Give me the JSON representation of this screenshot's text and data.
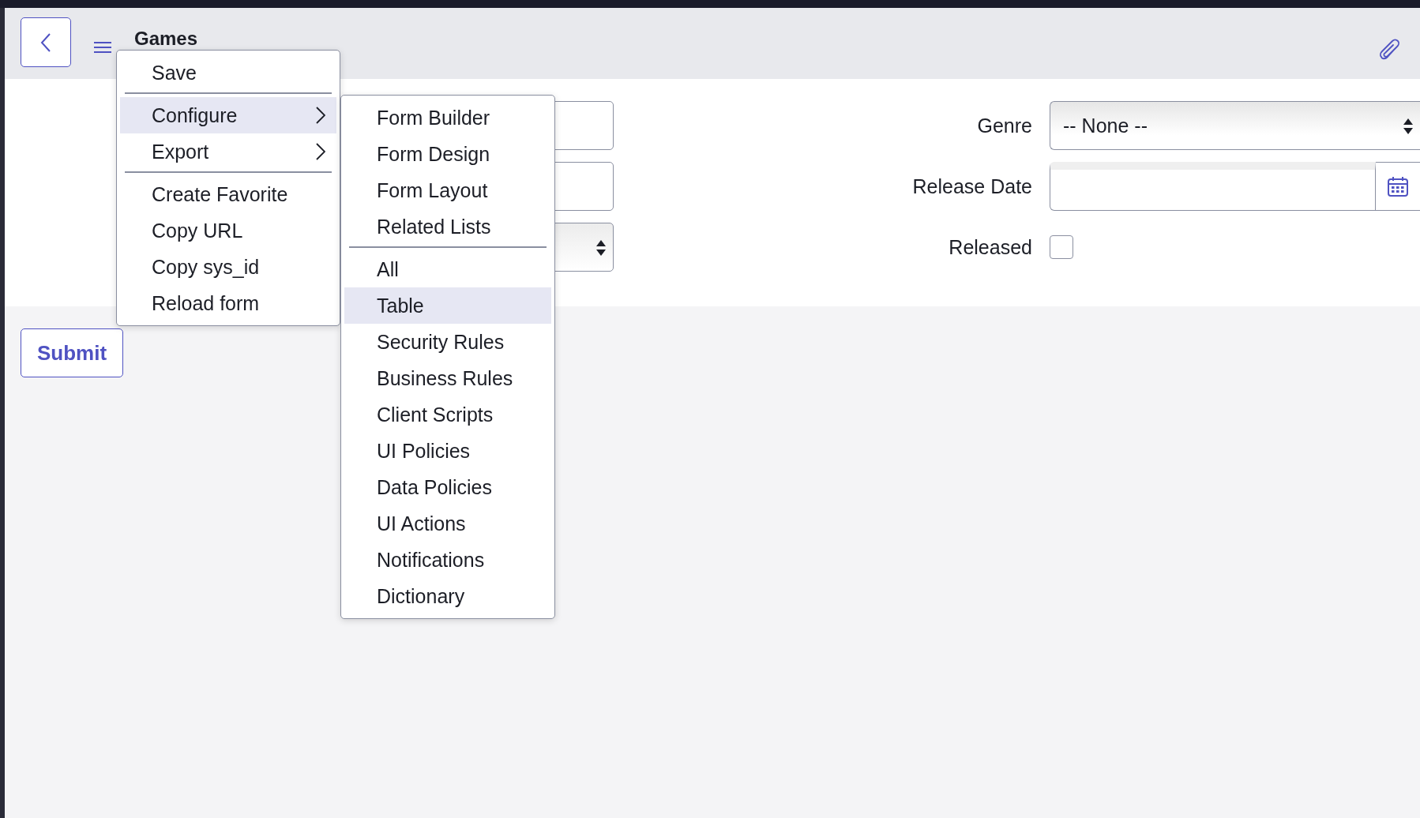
{
  "header": {
    "title": "Games"
  },
  "form": {
    "left_fields": [
      {
        "kind": "text"
      },
      {
        "kind": "text"
      },
      {
        "kind": "select"
      }
    ],
    "right_fields": [
      {
        "kind": "select",
        "label": "Genre",
        "value": "-- None --"
      },
      {
        "kind": "date",
        "label": "Release Date"
      },
      {
        "kind": "checkbox",
        "label": "Released",
        "checked": false
      }
    ]
  },
  "submit_button": {
    "label": "Submit"
  },
  "context_menu": {
    "groups": [
      [
        {
          "label": "Save",
          "selected": false,
          "has_submenu": false
        }
      ],
      [
        {
          "label": "Configure",
          "selected": true,
          "has_submenu": true
        },
        {
          "label": "Export",
          "selected": false,
          "has_submenu": true
        }
      ],
      [
        {
          "label": "Create Favorite",
          "selected": false,
          "has_submenu": false
        },
        {
          "label": "Copy URL",
          "selected": false,
          "has_submenu": false
        },
        {
          "label": "Copy sys_id",
          "selected": false,
          "has_submenu": false
        },
        {
          "label": "Reload form",
          "selected": false,
          "has_submenu": false
        }
      ]
    ]
  },
  "submenu": {
    "groups": [
      [
        {
          "label": "Form Builder",
          "selected": false
        },
        {
          "label": "Form Design",
          "selected": false
        },
        {
          "label": "Form Layout",
          "selected": false
        },
        {
          "label": "Related Lists",
          "selected": false
        }
      ],
      [
        {
          "label": "All",
          "selected": false
        },
        {
          "label": "Table",
          "selected": true
        },
        {
          "label": "Security Rules",
          "selected": false
        },
        {
          "label": "Business Rules",
          "selected": false
        },
        {
          "label": "Client Scripts",
          "selected": false
        },
        {
          "label": "UI Policies",
          "selected": false
        },
        {
          "label": "Data Policies",
          "selected": false
        },
        {
          "label": "UI Actions",
          "selected": false
        },
        {
          "label": "Notifications",
          "selected": false
        },
        {
          "label": "Dictionary",
          "selected": false
        }
      ]
    ]
  }
}
